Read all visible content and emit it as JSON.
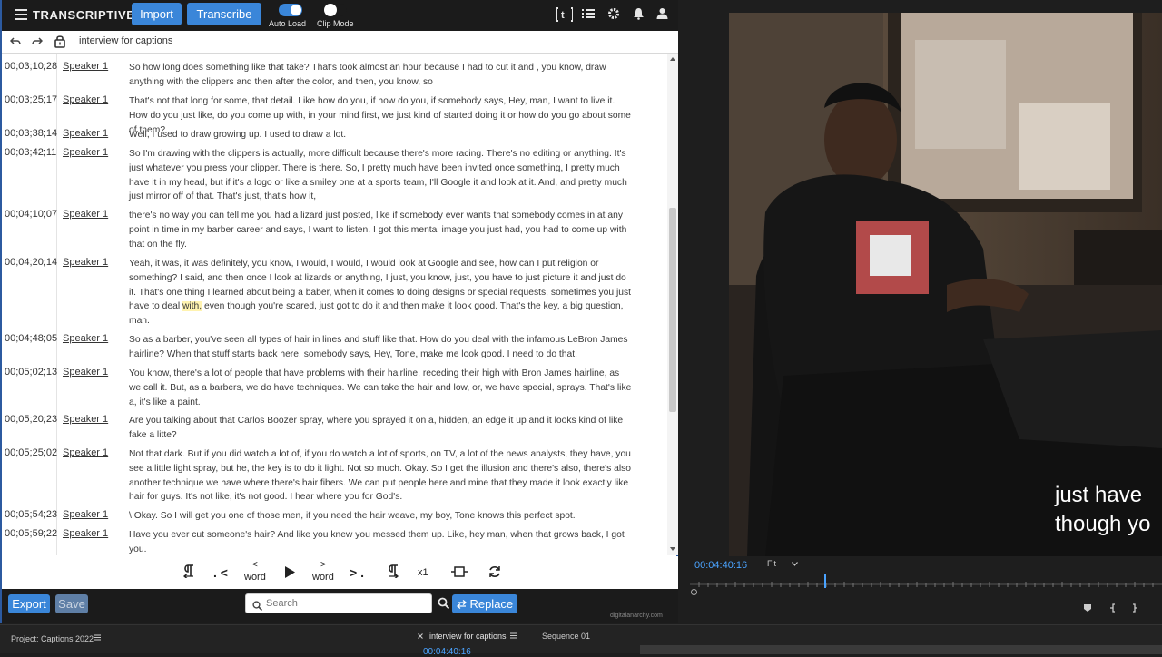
{
  "app": {
    "brand": "TRANSCRIPTIVE",
    "import_label": "Import",
    "transcribe_label": "Transcribe",
    "auto_load_label": "Auto Load",
    "clip_mode_label": "Clip Mode",
    "doc_title": "interview for captions"
  },
  "transcript": [
    {
      "tc": "00;03;10;28",
      "speaker": "Speaker 1",
      "text": "So how long does something like that take? That's took almost an hour because I had to cut it and , you know, draw anything with the clippers and then after the color, and then, you know, so"
    },
    {
      "tc": "00;03;25;17",
      "speaker": "Speaker 1",
      "text": "That's not that long for some, that detail. Like how do you, if how do you, if somebody says, Hey, man, I want to live it. How do you just like, do you come up with, in your mind first, we just kind of started doing it or how do you go about some of them?"
    },
    {
      "tc": "00;03;38;14",
      "speaker": "Speaker 1",
      "text": "Well, I used to draw growing up. I used to draw a lot."
    },
    {
      "tc": "00;03;42;11",
      "speaker": "Speaker 1",
      "text": "So I'm drawing with the clippers is actually, more difficult because there's more racing. There's no editing or anything. It's just whatever you press your clipper. There is there. So, I pretty much have been invited once something, I pretty much have it in my head, but if it's a logo or like a smiley one at a sports team, I'll Google it and look at it. And, and pretty much just mirror off of that. That's just, that's how it,"
    },
    {
      "tc": "00;04;10;07",
      "speaker": "Speaker 1",
      "text": "there's no way you can tell me you had a lizard just posted, like if somebody ever wants that somebody comes in at any point in time in my barber career and says, I want to listen. I got this mental image you just had, you had to come up with that on the fly."
    },
    {
      "tc": "00;04;20;14",
      "speaker": "Speaker 1",
      "text_before": "Yeah, it was, it was definitely, you know, I would, I would, I would look at Google and see, how can I put religion or something? I said, and then once I look at lizards or anything, I just, you know, just, you have to just picture it and just do it. That's one thing I learned about being a baber, when it comes to doing designs or special requests, sometimes you just have to deal ",
      "text_highlight": "with,",
      "text_after": " even though you're scared, just got to do it and then make it look good. That's the key, a big question, man."
    },
    {
      "tc": "00;04;48;05",
      "speaker": "Speaker 1",
      "text": "So as a barber, you've seen all types of hair in lines and stuff like that. How do you deal with the infamous LeBron James hairline? When that stuff starts back here, somebody says, Hey, Tone, make me look good. I need to do that."
    },
    {
      "tc": "00;05;02;13",
      "speaker": "Speaker 1",
      "text": "You know, there's a lot of people that have problems with their hairline, receding their high with Bron James hairline, as we call it. But, as a barbers, we do have techniques. We can take the hair and low, or, we have special, sprays. That's like a, it's like a paint."
    },
    {
      "tc": "00;05;20;23",
      "speaker": "Speaker 1",
      "text": "Are you talking about that Carlos Boozer spray, where you sprayed it on a, hidden, an edge it up and it looks kind of like fake a litte?"
    },
    {
      "tc": "00;05;25;02",
      "speaker": "Speaker 1",
      "text": "Not that dark. But if you did watch a lot of, if you do watch a lot of sports, on TV, a lot of the news analysts, they have, you see a little light spray, but he, the key is to do it light. Not so much. Okay. So I get the illusion and there's also, there's also another technique we have where there's hair fibers. We can put people here and mine that they made it look exactly like hair for guys. It's not like, it's not good. I hear where you for God's."
    },
    {
      "tc": "00;05;54;23",
      "speaker": "Speaker 1",
      "text": "\\ Okay. So I will get you one of those men, if  you need the hair weave, my boy, Tone knows this perfect spot."
    },
    {
      "tc": "00;05;59;22",
      "speaker": "Speaker 1",
      "text": "Have you ever cut someone's hair? And like you knew you messed them up. Like, hey man, when that grows back, I got you."
    }
  ],
  "controls": {
    "prev_word_small": "<",
    "prev_word_label": "word",
    "next_word_small": ">",
    "next_word_label": "word",
    "prev_sentence": ". <",
    "next_sentence": "> .",
    "speed": "x1"
  },
  "bottom": {
    "export_label": "Export",
    "save_label": "Save",
    "search_placeholder": "Search",
    "replace_label": "Replace",
    "credit": "digitalanarchy.com"
  },
  "premiere": {
    "caption_line1": "just have",
    "caption_line2": "though yo",
    "timecode": "00:04:40:16",
    "fit": "Fit",
    "project_tab": "Project: Captions 2022",
    "seq_tab": "interview for captions",
    "seq01_tab": "Sequence 01",
    "seq_timecode": "00:04:40:16"
  }
}
